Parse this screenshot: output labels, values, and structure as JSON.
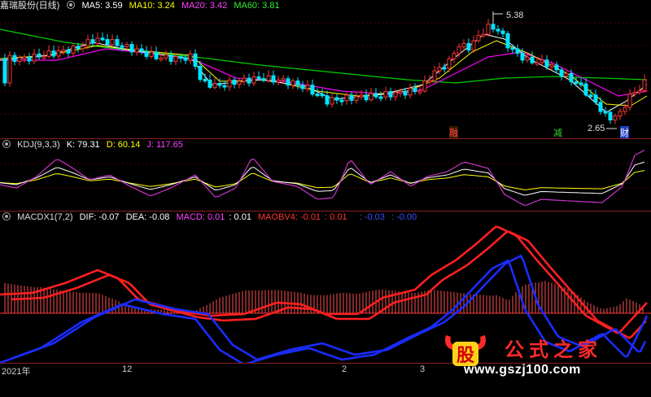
{
  "price_panel": {
    "title": "嘉瑞股份(日线)",
    "ma5": "MA5: 3.59",
    "ma10": "MA10: 3.24",
    "ma20": "MA20: 3.42",
    "ma60": "MA60: 3.81",
    "high_label": "5.38",
    "low_label": "2.65",
    "flag_1": "融",
    "flag_2": "减",
    "flag_3": "财",
    "colors": {
      "ma5": "#ffffff",
      "ma10": "#ffff00",
      "ma20": "#ff00ff",
      "ma60": "#00e000",
      "up": "#ff3333",
      "down": "#00e5ff"
    }
  },
  "kdj_panel": {
    "name": "KDJ(9,3,3)",
    "k": "K: 79.31",
    "d": "D: 60.14",
    "j": "J: 117.65"
  },
  "macd_panel": {
    "name": "MACDX1(7,2)",
    "dif": "DIF: -0.07",
    "dea": "DEA: -0.08",
    "macd": "MACD: 0.01",
    "macd_val": ": 0.01",
    "maobv": "MAOBV4: -0.01",
    "maobv_val": ": 0.01",
    "blue_1": ": -0.03",
    "blue_2": ": -0.00"
  },
  "time_axis": [
    "2021年",
    "12",
    "2",
    "3"
  ],
  "watermark": {
    "logo_text": "股",
    "title": "公式之家",
    "url": "www.gszj100.com"
  }
}
